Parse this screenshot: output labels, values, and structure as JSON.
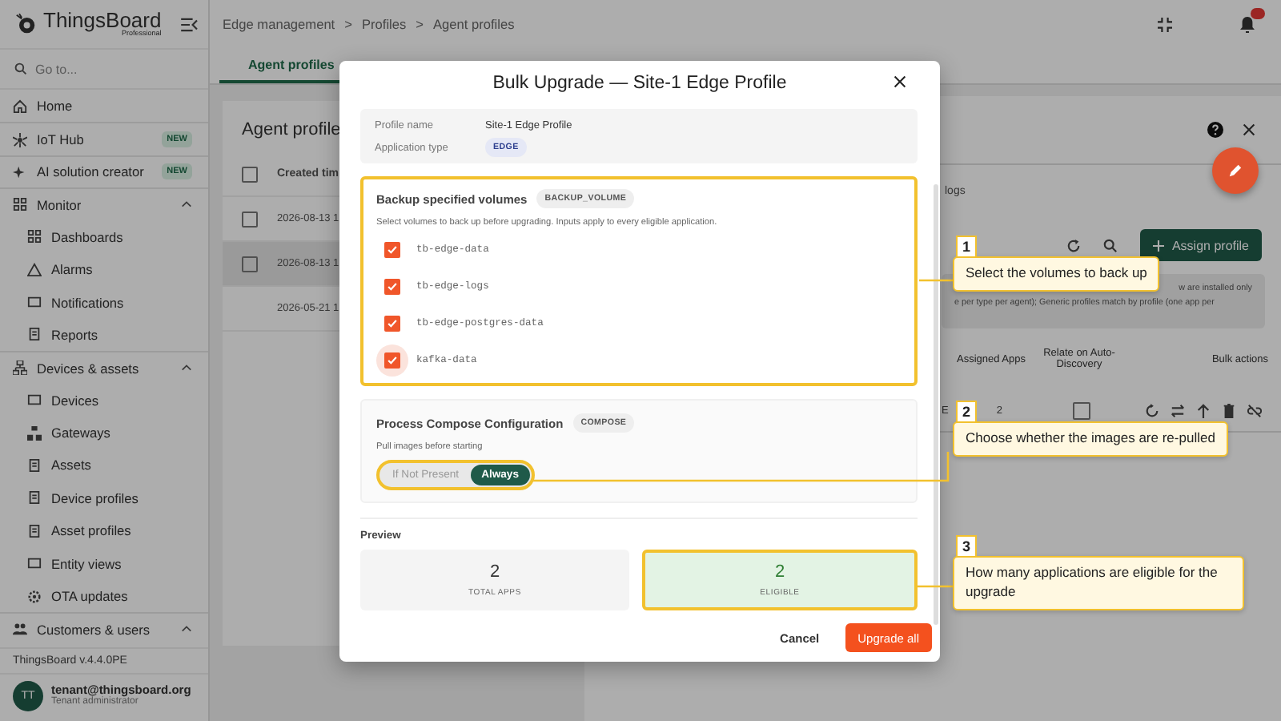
{
  "app": {
    "logo": "ThingsBoard",
    "logo_sub": "Professional"
  },
  "breadcrumbs": [
    "Edge management",
    "Profiles",
    "Agent profiles"
  ],
  "breadcrumb_separator": ">",
  "sidebar": {
    "search_placeholder": "Go to...",
    "items": [
      {
        "label": "Home",
        "kind": "top"
      },
      {
        "label": "IoT Hub",
        "kind": "top",
        "badge": "NEW"
      },
      {
        "label": "AI solution creator",
        "kind": "top",
        "badge": "NEW"
      },
      {
        "label": "Monitor",
        "kind": "group",
        "expanded": true
      },
      {
        "label": "Dashboards",
        "kind": "child"
      },
      {
        "label": "Alarms",
        "kind": "child"
      },
      {
        "label": "Notifications",
        "kind": "child"
      },
      {
        "label": "Reports",
        "kind": "child"
      },
      {
        "label": "Devices & assets",
        "kind": "group",
        "expanded": true
      },
      {
        "label": "Devices",
        "kind": "child"
      },
      {
        "label": "Gateways",
        "kind": "child"
      },
      {
        "label": "Assets",
        "kind": "child"
      },
      {
        "label": "Device profiles",
        "kind": "child"
      },
      {
        "label": "Asset profiles",
        "kind": "child"
      },
      {
        "label": "Entity views",
        "kind": "child"
      },
      {
        "label": "OTA updates",
        "kind": "child"
      },
      {
        "label": "Customers & users",
        "kind": "group",
        "expanded": true
      }
    ],
    "version": "ThingsBoard v.4.4.0PE",
    "user": {
      "initials": "TT",
      "email": "tenant@thingsboard.org",
      "role": "Tenant administrator"
    }
  },
  "tabs": [
    {
      "label": "Agent profiles",
      "selected": true
    }
  ],
  "list": {
    "title": "Agent profile",
    "column": "Created tim",
    "all_checked": false,
    "rows": [
      {
        "created": "2026-08-13 1",
        "selectable": true,
        "checked": false,
        "highlighted": false
      },
      {
        "created": "2026-08-13 1",
        "selectable": true,
        "checked": false,
        "highlighted": true
      },
      {
        "created": "2026-05-21 1",
        "selectable": false,
        "highlighted": false
      }
    ]
  },
  "details": {
    "tab_fragment": "logs",
    "assign_button": "Assign profile",
    "info_lines": [
      "w are installed only",
      "e per type per agent); Generic profiles match by profile (one app per"
    ],
    "columns": [
      "Assigned Apps",
      "Relate on Auto-Discovery",
      "Bulk actions"
    ],
    "row": {
      "column_1": "E",
      "assigned_apps": "2",
      "relate": false
    }
  },
  "dialog": {
    "title": "Bulk Upgrade — Site-1 Edge Profile",
    "info": [
      {
        "label": "Profile name",
        "value": "Site-1 Edge Profile",
        "kind": "text"
      },
      {
        "label": "Application type",
        "value": "EDGE",
        "kind": "chip"
      }
    ],
    "backup": {
      "title": "Backup specified volumes",
      "chip": "BACKUP_VOLUME",
      "highlighted": true,
      "description": "Select volumes to back up before upgrading. Inputs apply to every eligible application.",
      "volumes": [
        {
          "name": "tb-edge-data",
          "checked": true,
          "focused": false
        },
        {
          "name": "tb-edge-logs",
          "checked": true,
          "focused": false
        },
        {
          "name": "tb-edge-postgres-data",
          "checked": true,
          "focused": false
        },
        {
          "name": "kafka-data",
          "checked": true,
          "focused": true
        }
      ]
    },
    "compose": {
      "title": "Process Compose Configuration",
      "chip": "COMPOSE",
      "label": "Pull images before starting",
      "highlighted": true,
      "options": [
        {
          "label": "If Not Present",
          "selected": false
        },
        {
          "label": "Always",
          "selected": true
        }
      ]
    },
    "preview": {
      "title": "Preview",
      "cards": [
        {
          "value": "2",
          "label": "TOTAL APPS",
          "kind": "neutral",
          "highlighted": false
        },
        {
          "value": "2",
          "label": "ELIGIBLE",
          "kind": "eligible",
          "highlighted": true
        }
      ]
    },
    "buttons": [
      {
        "label": "Cancel",
        "kind": "text"
      },
      {
        "label": "Upgrade all",
        "kind": "primary"
      }
    ]
  },
  "callouts": [
    {
      "number": "1",
      "text": "Select the volumes to back up"
    },
    {
      "number": "2",
      "text": "Choose whether the images are re-pulled"
    },
    {
      "number": "3",
      "text": "How many applications are eligible for the upgrade"
    }
  ]
}
